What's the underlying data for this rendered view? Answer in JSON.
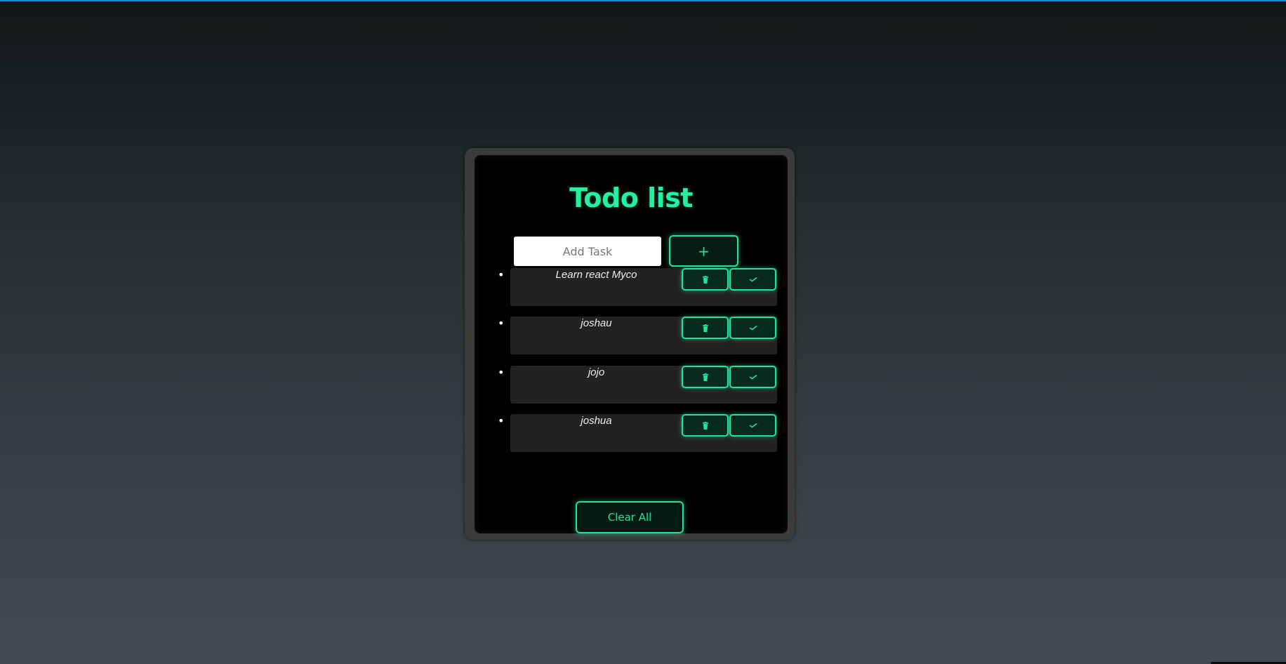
{
  "app": {
    "title": "Todo list",
    "accent_color": "#24f0a0"
  },
  "input": {
    "placeholder": "Add Task",
    "value": ""
  },
  "add_button": {
    "label": "+"
  },
  "tasks": [
    {
      "text": "Learn react Myco",
      "delete_icon": "trash-icon",
      "complete_icon": "check-icon"
    },
    {
      "text": "joshau",
      "delete_icon": "trash-icon",
      "complete_icon": "check-icon"
    },
    {
      "text": "jojo",
      "delete_icon": "trash-icon",
      "complete_icon": "check-icon"
    },
    {
      "text": "joshua",
      "delete_icon": "trash-icon",
      "complete_icon": "check-icon"
    }
  ],
  "clear_button": {
    "label": "Clear All"
  }
}
